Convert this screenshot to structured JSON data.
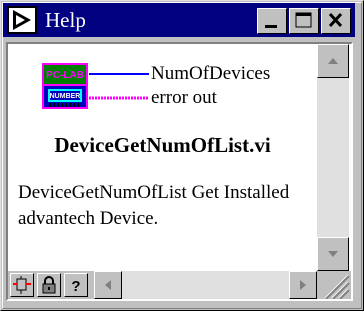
{
  "window": {
    "title": "Help"
  },
  "vi": {
    "icon_text_top": "PC-LAB",
    "icon_text_bottom": "NUMBER",
    "terminals": [
      {
        "label": "NumOfDevices",
        "wire_color": "#0000ff",
        "wire_style": "solid"
      },
      {
        "label": "error out",
        "wire_color": "#ff00ff",
        "wire_style": "dashed"
      }
    ],
    "name": "DeviceGetNumOfList.vi",
    "description": "DeviceGetNumOfList Get Installed advantech Device."
  },
  "toolbar": {
    "icons": [
      "simple-diagram-icon",
      "lock-icon",
      "question-icon"
    ]
  },
  "colors": {
    "titlebar": "#000080",
    "window_face": "#c0c0c0",
    "icon_top": "#008000",
    "icon_bottom": "#0000c0",
    "icon_text_top": "#ff00ff",
    "icon_frame": "#ff00ff"
  }
}
